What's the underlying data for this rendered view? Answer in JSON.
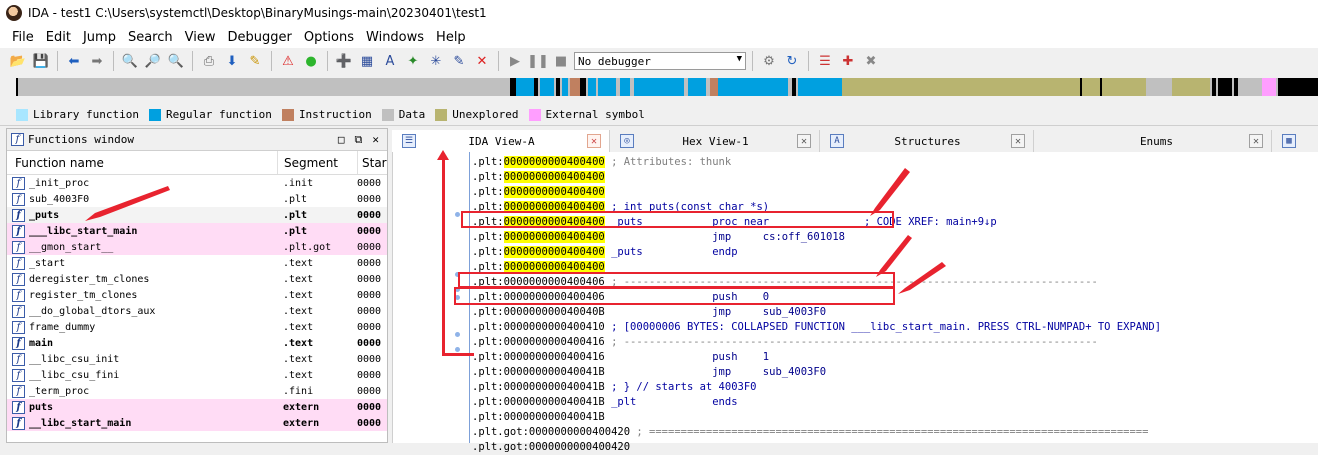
{
  "window": {
    "title": "IDA - test1 C:\\Users\\systemctl\\Desktop\\BinaryMusings-main\\20230401\\test1"
  },
  "menu": [
    "File",
    "Edit",
    "Jump",
    "Search",
    "View",
    "Debugger",
    "Options",
    "Windows",
    "Help"
  ],
  "toolbar": {
    "debugger_select": "No debugger"
  },
  "legend": [
    {
      "label": "Library function",
      "color": "#a8e6ff"
    },
    {
      "label": "Regular function",
      "color": "#00a0e0"
    },
    {
      "label": "Instruction",
      "color": "#c08060"
    },
    {
      "label": "Data",
      "color": "#c0c0c0"
    },
    {
      "label": "Unexplored",
      "color": "#b8b470"
    },
    {
      "label": "External symbol",
      "color": "#ff9eff"
    }
  ],
  "functions_window": {
    "title": "Functions window",
    "columns": {
      "name": "Function name",
      "segment": "Segment",
      "start": "Star"
    },
    "rows": [
      {
        "name": "_init_proc",
        "segment": ".init",
        "start": "0000",
        "style": "normal"
      },
      {
        "name": "sub_4003F0",
        "segment": ".plt",
        "start": "0000",
        "style": "normal"
      },
      {
        "name": "_puts",
        "segment": ".plt",
        "start": "0000",
        "style": "selected-bold"
      },
      {
        "name": "___libc_start_main",
        "segment": ".plt",
        "start": "0000",
        "style": "pink-bold"
      },
      {
        "name": "__gmon_start__",
        "segment": ".plt.got",
        "start": "0000",
        "style": "pink"
      },
      {
        "name": "_start",
        "segment": ".text",
        "start": "0000",
        "style": "normal"
      },
      {
        "name": "deregister_tm_clones",
        "segment": ".text",
        "start": "0000",
        "style": "normal"
      },
      {
        "name": "register_tm_clones",
        "segment": ".text",
        "start": "0000",
        "style": "normal"
      },
      {
        "name": "__do_global_dtors_aux",
        "segment": ".text",
        "start": "0000",
        "style": "normal"
      },
      {
        "name": "frame_dummy",
        "segment": ".text",
        "start": "0000",
        "style": "normal"
      },
      {
        "name": "main",
        "segment": ".text",
        "start": "0000",
        "style": "bold"
      },
      {
        "name": "__libc_csu_init",
        "segment": ".text",
        "start": "0000",
        "style": "normal"
      },
      {
        "name": "__libc_csu_fini",
        "segment": ".text",
        "start": "0000",
        "style": "normal"
      },
      {
        "name": "_term_proc",
        "segment": ".fini",
        "start": "0000",
        "style": "normal"
      },
      {
        "name": "puts",
        "segment": "extern",
        "start": "0000",
        "style": "pink-bold"
      },
      {
        "name": "__libc_start_main",
        "segment": "extern",
        "start": "0000",
        "style": "pink-bold"
      }
    ]
  },
  "tabs": [
    {
      "label": "IDA View-A",
      "active": true
    },
    {
      "label": "Hex View-1",
      "active": false
    },
    {
      "label": "Structures",
      "active": false
    },
    {
      "label": "Enums",
      "active": false
    }
  ],
  "disasm": [
    {
      "seg": ".plt:",
      "addr": "0000000000400400",
      "hl": true,
      "rest": " ; Attributes: thunk",
      "cls": "cmt"
    },
    {
      "seg": ".plt:",
      "addr": "0000000000400400",
      "hl": true,
      "rest": "",
      "cls": ""
    },
    {
      "seg": ".plt:",
      "addr": "0000000000400400",
      "hl": true,
      "rest": "",
      "cls": ""
    },
    {
      "seg": ".plt:",
      "addr": "0000000000400400",
      "hl": true,
      "rest": " ; int puts(const char *s)",
      "cls": "c-blue"
    },
    {
      "seg": ".plt:",
      "addr": "0000000000400400",
      "hl": true,
      "rest": " _puts           proc near               ; CODE XREF: main+9↓p",
      "cls": "c-blue"
    },
    {
      "seg": ".plt:",
      "addr": "0000000000400400",
      "hl": true,
      "rest": "                 jmp     cs:off_601018",
      "cls": "kw"
    },
    {
      "seg": ".plt:",
      "addr": "0000000000400400",
      "hl": true,
      "rest": " _puts           endp",
      "cls": "c-blue"
    },
    {
      "seg": ".plt:",
      "addr": "0000000000400400",
      "hl": true,
      "rest": "",
      "cls": ""
    },
    {
      "seg": ".plt:",
      "addr": "0000000000400406",
      "hl": false,
      "rest": " ; ---------------------------------------------------------------------------",
      "cls": "dash"
    },
    {
      "seg": ".plt:",
      "addr": "0000000000400406",
      "hl": false,
      "rest": "                 push    0",
      "cls": "kw"
    },
    {
      "seg": ".plt:",
      "addr": "000000000040040B",
      "hl": false,
      "rest": "                 jmp     sub_4003F0",
      "cls": "kw"
    },
    {
      "seg": ".plt:",
      "addr": "0000000000400410",
      "hl": false,
      "rest": " ; [00000006 BYTES: COLLAPSED FUNCTION ___libc_start_main. PRESS CTRL-NUMPAD+ TO EXPAND]",
      "cls": "c-blue"
    },
    {
      "seg": ".plt:",
      "addr": "0000000000400416",
      "hl": false,
      "rest": " ; ---------------------------------------------------------------------------",
      "cls": "dash"
    },
    {
      "seg": ".plt:",
      "addr": "0000000000400416",
      "hl": false,
      "rest": "                 push    1",
      "cls": "kw"
    },
    {
      "seg": ".plt:",
      "addr": "000000000040041B",
      "hl": false,
      "rest": "                 jmp     sub_4003F0",
      "cls": "kw"
    },
    {
      "seg": ".plt:",
      "addr": "000000000040041B",
      "hl": false,
      "rest": " ; } // starts at 4003F0",
      "cls": "c-blue"
    },
    {
      "seg": ".plt:",
      "addr": "000000000040041B",
      "hl": false,
      "rest": " _plt            ends",
      "cls": "c-blue"
    },
    {
      "seg": ".plt:",
      "addr": "000000000040041B",
      "hl": false,
      "rest": "",
      "cls": ""
    },
    {
      "seg": ".plt.got:",
      "addr": "0000000000400420",
      "hl": false,
      "rest": " ; ===============================================================================",
      "cls": "dash"
    },
    {
      "seg": ".plt.got:",
      "addr": "0000000000400420",
      "hl": false,
      "rest": "",
      "cls": ""
    }
  ]
}
